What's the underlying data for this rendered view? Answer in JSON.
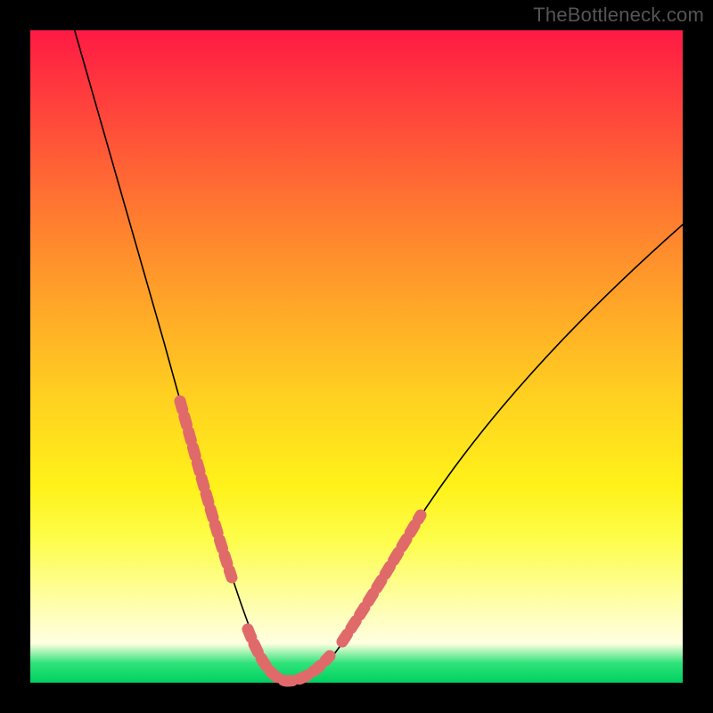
{
  "watermark": "TheBottleneck.com",
  "chart_data": {
    "type": "line",
    "title": "",
    "xlabel": "",
    "ylabel": "",
    "xlim": [
      0,
      100
    ],
    "ylim": [
      0,
      100
    ],
    "series": [
      {
        "name": "bottleneck-curve",
        "x": [
          5,
          8,
          12,
          16,
          20,
          24,
          27,
          30,
          32,
          34,
          36,
          38,
          40,
          44,
          48,
          52,
          58,
          66,
          76,
          88,
          100
        ],
        "y": [
          100,
          86,
          70,
          55,
          42,
          30,
          21,
          13,
          8,
          4,
          1,
          0,
          0,
          2,
          7,
          13,
          22,
          34,
          47,
          61,
          72
        ]
      }
    ],
    "highlight_segments": [
      {
        "name": "left-dots",
        "x_range": [
          20,
          30
        ]
      },
      {
        "name": "valley-dots",
        "x_range": [
          32,
          44
        ]
      },
      {
        "name": "right-dots",
        "x_range": [
          46,
          56
        ]
      }
    ],
    "background_gradient": {
      "top": "#ff1a44",
      "mid": "#fff21a",
      "bottom": "#00d060"
    }
  }
}
